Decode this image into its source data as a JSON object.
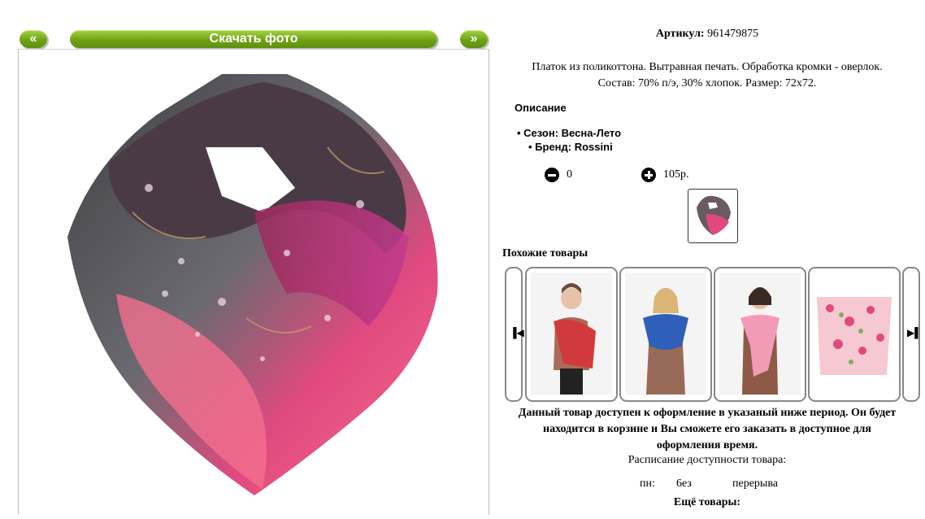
{
  "gallery": {
    "prev_label": "«",
    "next_label": "»",
    "download_label": "Скачать фото"
  },
  "product": {
    "article_label": "Артикул:",
    "article_value": "961479875",
    "description_line1": "Платок из поликоттона. Вытравная печать. Обработка кромки - оверлок.",
    "description_line2": "Состав: 70% п/э, 30% хлопок. Размер: 72х72.",
    "section_title": "Описание",
    "properties": [
      "Сезон: Весна-Лето",
      "Бренд: Rossini"
    ],
    "quantity": "0",
    "price": "105р."
  },
  "similar": {
    "title": "Похожие товары",
    "prev_icon": "skip-back-icon",
    "next_icon": "skip-forward-icon",
    "items": [
      {
        "image": "woman-red-scarf-photo"
      },
      {
        "image": "woman-blue-scarf-photo"
      },
      {
        "image": "woman-pink-scarf-photo"
      },
      {
        "image": "floral-scarf-photo"
      }
    ]
  },
  "availability": {
    "notice_line1": "Данный товар доступен к оформление в указаный ниже период. Он будет",
    "notice_line2": "находится в корзине и Вы сможете его заказать в доступное для",
    "notice_line3": "оформления время.",
    "schedule_title": "Расписание доступности товара:",
    "schedule_day": "пн:",
    "schedule_from": "6ез",
    "schedule_to": "перерыва",
    "more_label": "Ещё товары:"
  },
  "colors": {
    "button_green": "#6fa314",
    "scarf_pink": "#e0497f",
    "scarf_magenta": "#c43a8f",
    "scarf_gray": "#5a5a5e"
  }
}
